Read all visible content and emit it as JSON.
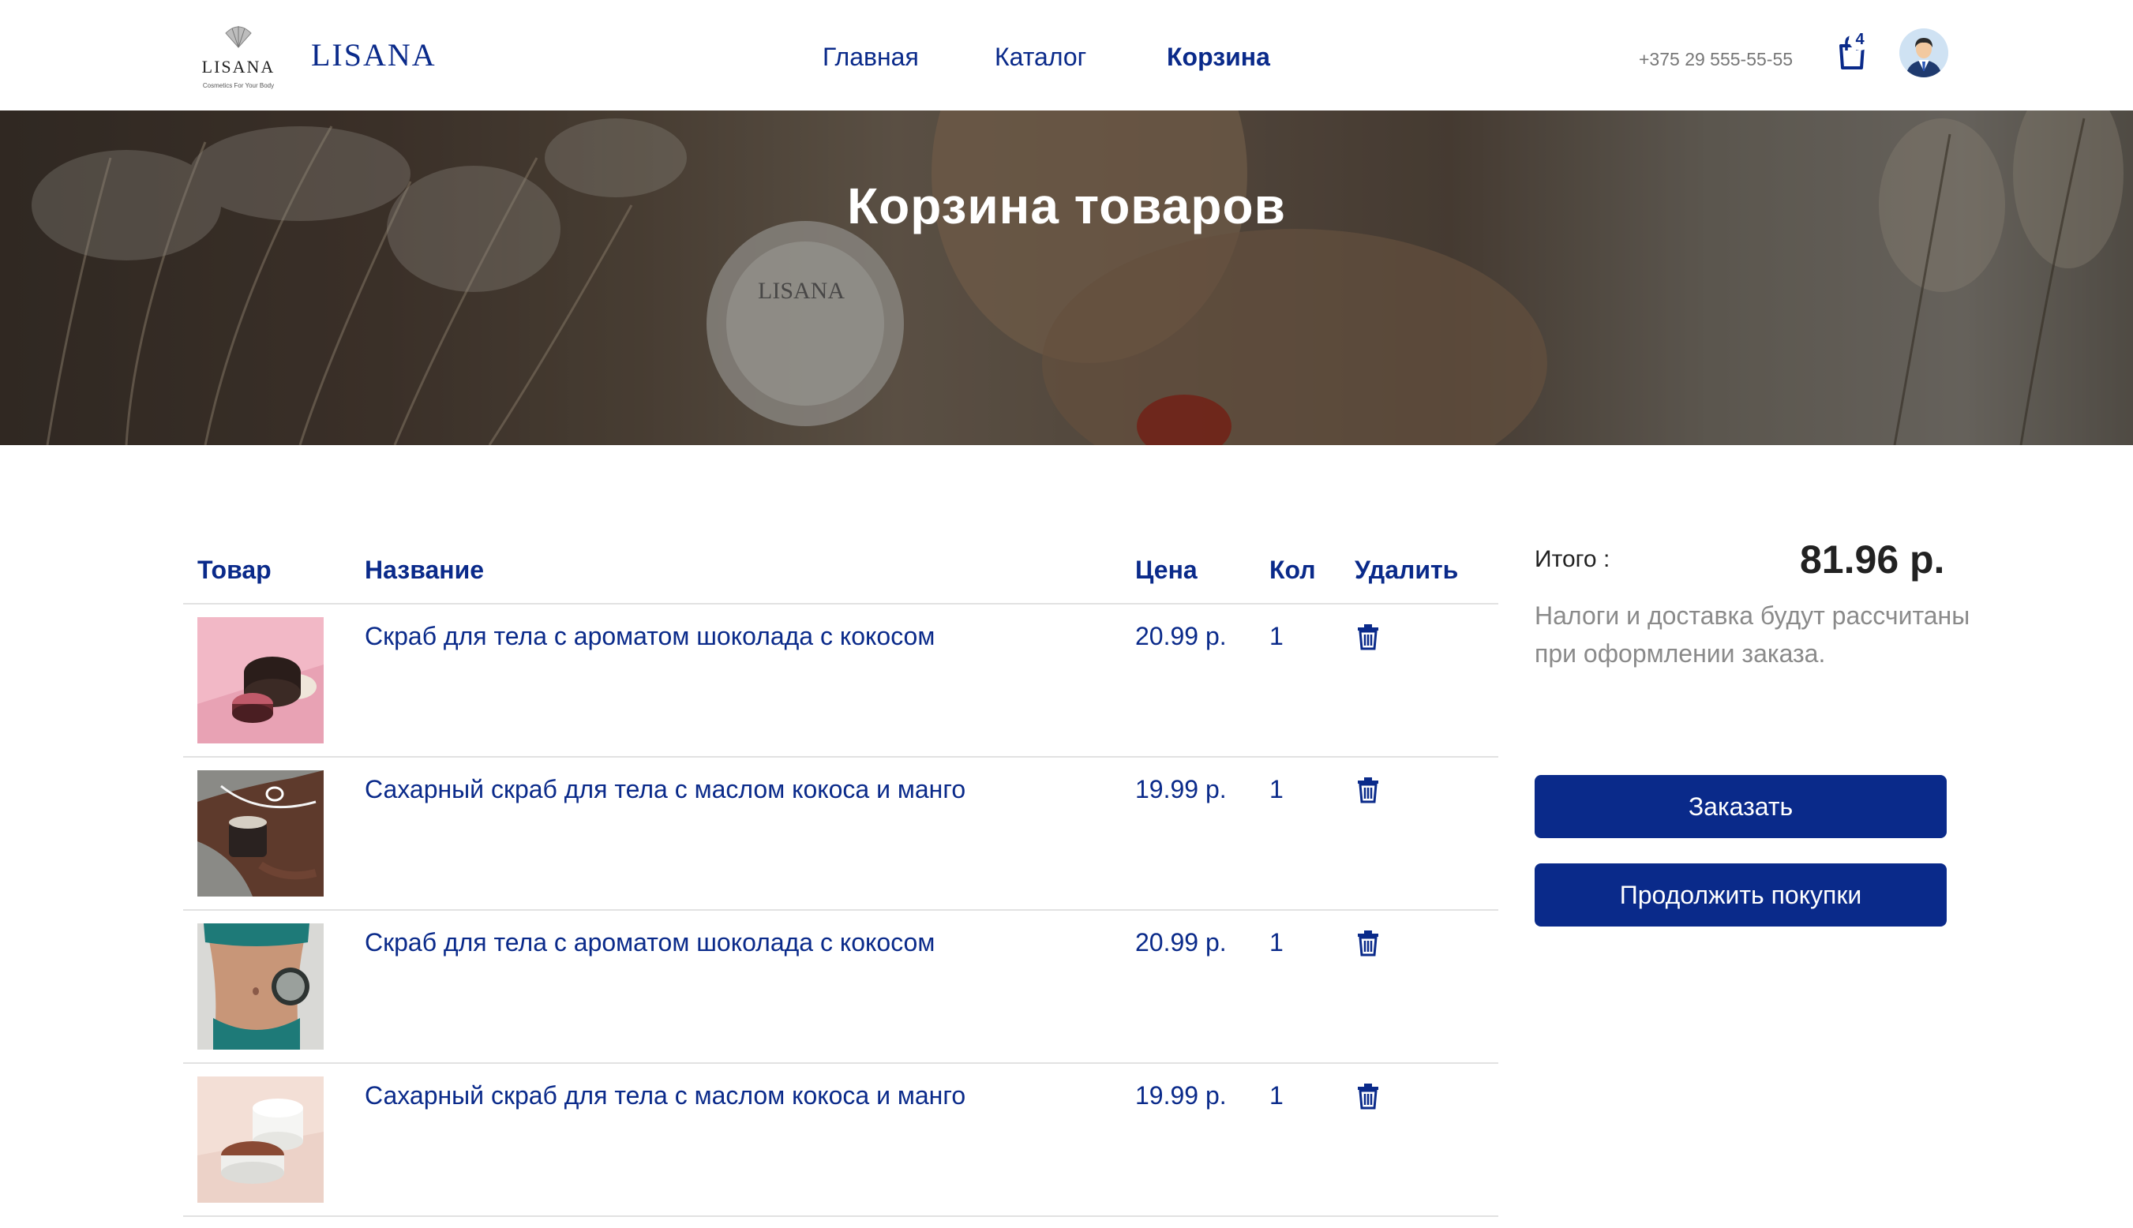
{
  "header": {
    "logo_text": "LISANA",
    "logo_subtext": "Cosmetics For Your Body",
    "brand": "LISANA",
    "nav": [
      {
        "label": "Главная",
        "active": false
      },
      {
        "label": "Каталог",
        "active": false
      },
      {
        "label": "Корзина",
        "active": true
      }
    ],
    "phone": "+375 29 555-55-55",
    "cart_count": "4",
    "icons": [
      "shopping-bag-icon",
      "user-avatar-icon"
    ]
  },
  "hero": {
    "title": "Корзина товаров"
  },
  "table": {
    "headers": [
      "Товар",
      "Название",
      "Цена",
      "Кол",
      "Удалить"
    ],
    "rows": [
      {
        "name": "Скраб для тела с ароматом шоколада с кокосом",
        "price": "20.99 р.",
        "qty": "1"
      },
      {
        "name": "Сахарный скраб для тела с маслом кокоса и манго",
        "price": "19.99 р.",
        "qty": "1"
      },
      {
        "name": "Скраб для тела с ароматом шоколада с кокосом",
        "price": "20.99 р.",
        "qty": "1"
      },
      {
        "name": "Сахарный скраб для тела с маслом кокоса и манго",
        "price": "19.99 р.",
        "qty": "1"
      }
    ]
  },
  "summary": {
    "label": "Итого :",
    "total": "81.96 р.",
    "note": "Налоги и доставка будут рассчитаны при оформлении заказа.",
    "order_button": "Заказать",
    "continue_button": "Продолжить покупки"
  },
  "colors": {
    "accent": "#0a2a8a",
    "muted_text": "#8a8a8a",
    "divider": "#e2e2e2"
  }
}
